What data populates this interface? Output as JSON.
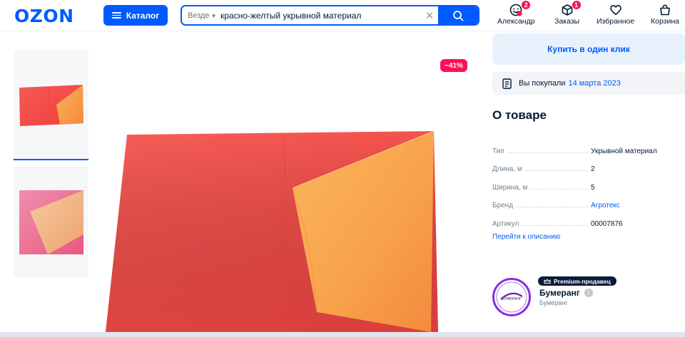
{
  "header": {
    "logo": "OZON",
    "catalog_label": "Каталог",
    "search": {
      "scope": "Везде",
      "query": "красно-желтый укрывной материал"
    },
    "nav": [
      {
        "label": "Александр",
        "icon": "profile-face-icon",
        "badge": "2"
      },
      {
        "label": "Заказы",
        "icon": "box-icon",
        "badge": "1"
      },
      {
        "label": "Избранное",
        "icon": "heart-icon"
      },
      {
        "label": "Корзина",
        "icon": "cart-bag-icon"
      }
    ]
  },
  "gallery": {
    "discount": "−41%",
    "thumb_count": 2,
    "active_thumb": 1
  },
  "sidebar": {
    "buy_one_click": "Купить в один клик",
    "purchased_text": "Вы покупали",
    "purchased_date": "14 марта 2023",
    "about_title": "О товаре",
    "specs": [
      {
        "key": "Тип",
        "value": "Укрывной материал"
      },
      {
        "key": "Длина, м",
        "value": "2"
      },
      {
        "key": "Ширина, м",
        "value": "5"
      },
      {
        "key": "Бренд",
        "value": "Агротекс"
      },
      {
        "key": "Артикул",
        "value": "00007876"
      }
    ],
    "go_to_description": "Перейти к описанию",
    "seller": {
      "premium_label": "Premium-продавец",
      "name": "Бумеранг",
      "subtitle": "Бумеранг",
      "logo_text": "БУМЕРАНГ"
    }
  },
  "colors": {
    "brand": "#005bff",
    "discount": "#f91155",
    "fabric_red": "#f2544f",
    "fabric_orange": "#f7a04a"
  }
}
